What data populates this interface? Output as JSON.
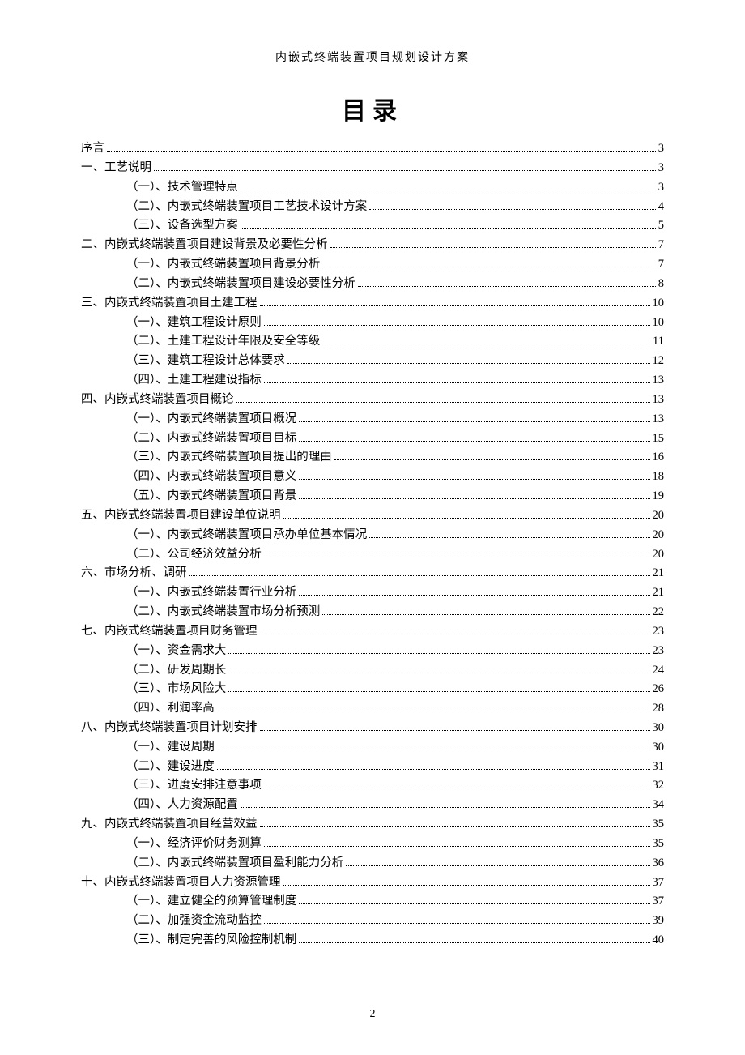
{
  "header": "内嵌式终端装置项目规划设计方案",
  "title": "目录",
  "page_number": "2",
  "toc": [
    {
      "level": 0,
      "label": "序言",
      "page": "3"
    },
    {
      "level": 0,
      "label": "一、工艺说明",
      "page": "3"
    },
    {
      "level": 1,
      "label": "（一）、技术管理特点",
      "page": "3"
    },
    {
      "level": 1,
      "label": "（二）、内嵌式终端装置项目工艺技术设计方案",
      "page": "4"
    },
    {
      "level": 1,
      "label": "（三）、设备选型方案",
      "page": "5"
    },
    {
      "level": 0,
      "label": "二、内嵌式终端装置项目建设背景及必要性分析",
      "page": "7"
    },
    {
      "level": 1,
      "label": "（一）、内嵌式终端装置项目背景分析",
      "page": "7"
    },
    {
      "level": 1,
      "label": "（二）、内嵌式终端装置项目建设必要性分析",
      "page": "8"
    },
    {
      "level": 0,
      "label": "三、内嵌式终端装置项目土建工程",
      "page": "10"
    },
    {
      "level": 1,
      "label": "（一）、建筑工程设计原则",
      "page": "10"
    },
    {
      "level": 1,
      "label": "（二）、土建工程设计年限及安全等级",
      "page": "11"
    },
    {
      "level": 1,
      "label": "（三）、建筑工程设计总体要求",
      "page": "12"
    },
    {
      "level": 1,
      "label": "（四）、土建工程建设指标",
      "page": "13"
    },
    {
      "level": 0,
      "label": "四、内嵌式终端装置项目概论",
      "page": "13"
    },
    {
      "level": 1,
      "label": "（一）、内嵌式终端装置项目概况",
      "page": "13"
    },
    {
      "level": 1,
      "label": "（二）、内嵌式终端装置项目目标",
      "page": "15"
    },
    {
      "level": 1,
      "label": "（三）、内嵌式终端装置项目提出的理由",
      "page": "16"
    },
    {
      "level": 1,
      "label": "（四）、内嵌式终端装置项目意义",
      "page": "18"
    },
    {
      "level": 1,
      "label": "（五）、内嵌式终端装置项目背景",
      "page": "19"
    },
    {
      "level": 0,
      "label": "五、内嵌式终端装置项目建设单位说明",
      "page": "20"
    },
    {
      "level": 1,
      "label": "（一）、内嵌式终端装置项目承办单位基本情况",
      "page": "20"
    },
    {
      "level": 1,
      "label": "（二）、公司经济效益分析",
      "page": "20"
    },
    {
      "level": 0,
      "label": "六、市场分析、调研",
      "page": "21"
    },
    {
      "level": 1,
      "label": "（一）、内嵌式终端装置行业分析",
      "page": "21"
    },
    {
      "level": 1,
      "label": "（二）、内嵌式终端装置市场分析预测",
      "page": "22"
    },
    {
      "level": 0,
      "label": "七、内嵌式终端装置项目财务管理",
      "page": "23"
    },
    {
      "level": 1,
      "label": "（一）、资金需求大",
      "page": "23"
    },
    {
      "level": 1,
      "label": "（二）、研发周期长",
      "page": "24"
    },
    {
      "level": 1,
      "label": "（三）、市场风险大",
      "page": "26"
    },
    {
      "level": 1,
      "label": "（四）、利润率高",
      "page": "28"
    },
    {
      "level": 0,
      "label": "八、内嵌式终端装置项目计划安排",
      "page": "30"
    },
    {
      "level": 1,
      "label": "（一）、建设周期",
      "page": "30"
    },
    {
      "level": 1,
      "label": "（二）、建设进度",
      "page": "31"
    },
    {
      "level": 1,
      "label": "（三）、进度安排注意事项",
      "page": "32"
    },
    {
      "level": 1,
      "label": "（四）、人力资源配置",
      "page": "34"
    },
    {
      "level": 0,
      "label": "九、内嵌式终端装置项目经营效益",
      "page": "35"
    },
    {
      "level": 1,
      "label": "（一）、经济评价财务测算",
      "page": "35"
    },
    {
      "level": 1,
      "label": "（二）、内嵌式终端装置项目盈利能力分析",
      "page": "36"
    },
    {
      "level": 0,
      "label": "十、内嵌式终端装置项目人力资源管理",
      "page": "37"
    },
    {
      "level": 1,
      "label": "（一）、建立健全的预算管理制度",
      "page": "37"
    },
    {
      "level": 1,
      "label": "（二）、加强资金流动监控",
      "page": "39"
    },
    {
      "level": 1,
      "label": "（三）、制定完善的风险控制机制",
      "page": "40"
    }
  ]
}
